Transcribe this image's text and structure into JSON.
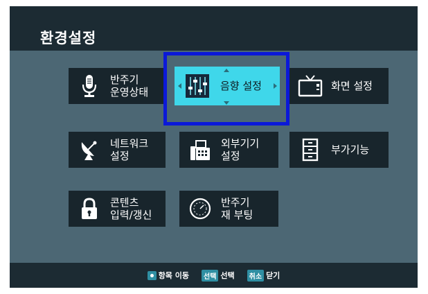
{
  "header": {
    "title": "환경설정"
  },
  "menu": {
    "items": [
      {
        "label": "반주기\n운영상태",
        "icon": "microphone-icon"
      },
      {
        "label": "음향 설정",
        "icon": "equalizer-sliders-icon",
        "selected": true
      },
      {
        "label": "화면 설정",
        "icon": "tv-icon"
      },
      {
        "label": "네트워크\n설정",
        "icon": "satellite-dish-icon"
      },
      {
        "label": "외부기기\n설정",
        "icon": "fax-machine-icon"
      },
      {
        "label": "부가기능",
        "icon": "cabinet-icon"
      },
      {
        "label": "콘텐츠\n입력/갱신",
        "icon": "lock-icon"
      },
      {
        "label": "반주기\n재 부팅",
        "icon": "reboot-dial-icon"
      }
    ]
  },
  "footer": {
    "move_label": "항목 이동",
    "select_key": "선택",
    "select_label": "선택",
    "cancel_key": "취소",
    "cancel_label": "닫기"
  },
  "colors": {
    "background": "#4c6774",
    "header": "#1c2b33",
    "tile": "#18252c",
    "selected_tile": "#3fd7ea",
    "selection_frame": "#0b19d8",
    "accent": "#2f8fa3"
  }
}
